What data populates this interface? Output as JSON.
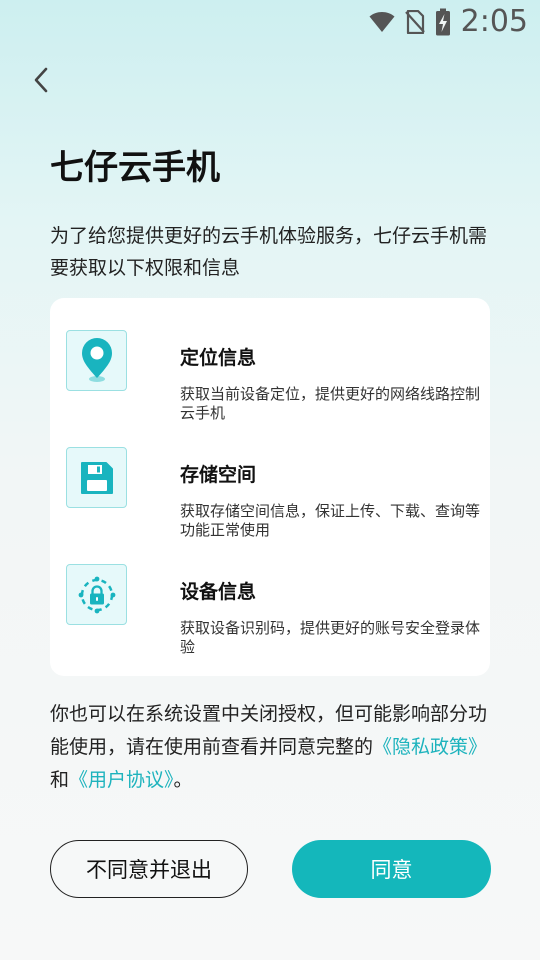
{
  "status_bar": {
    "time": "2:05",
    "icons": [
      "wifi-icon",
      "no-sim-icon",
      "battery-charging-icon"
    ]
  },
  "header": {
    "back_icon": "chevron-left-icon"
  },
  "app_title": "七仔云手机",
  "intro": "为了给您提供更好的云手机体验服务，七仔云手机需要获取以下权限和信息",
  "permissions": [
    {
      "icon": "location-pin-icon",
      "title": "定位信息",
      "desc": "获取当前设备定位，提供更好的网络线路控制云手机"
    },
    {
      "icon": "floppy-disk-icon",
      "title": "存储空间",
      "desc": "获取存储空间信息，保证上传、下载、查询等功能正常使用"
    },
    {
      "icon": "device-lock-icon",
      "title": "设备信息",
      "desc": "获取设备识别码，提供更好的账号安全登录体验"
    }
  ],
  "note": {
    "text_before": "你也可以在系统设置中关闭授权，但可能影响部分功能使用，请在使用前查看并同意完整的",
    "privacy_link": "《隐私政策》",
    "text_and": "和",
    "user_link": "《用户协议》",
    "text_end": "。"
  },
  "buttons": {
    "disagree": "不同意并退出",
    "agree": "同意"
  },
  "colors": {
    "accent": "#14b7bb",
    "link": "#1db3bd",
    "icon_bg": "#e6f9fa",
    "icon_border": "#9be0e2"
  }
}
